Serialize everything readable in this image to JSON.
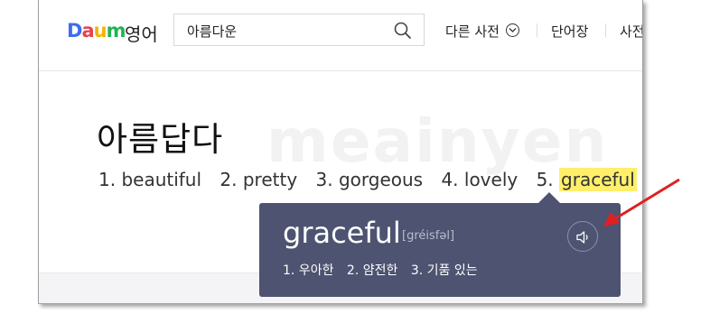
{
  "header": {
    "logo": "Daum",
    "section": "영어",
    "search_value": "아름다운",
    "nav": [
      "다른 사전",
      "단어장",
      "사전"
    ]
  },
  "watermark": "meainyen",
  "entry": {
    "word": "아름답다",
    "meanings": [
      "1. beautiful",
      "2. pretty",
      "3. gorgeous",
      "4. lovely",
      "5. "
    ],
    "highlighted": "graceful"
  },
  "popup": {
    "word": "graceful",
    "phonetic": "[gréisfəl]",
    "meanings": [
      "1. 우아한",
      "2. 얌전한",
      "3. 기품 있는"
    ]
  },
  "colors": {
    "popup_bg": "#4d5370",
    "highlight": "#ffef6b",
    "arrow": "#e02020"
  }
}
